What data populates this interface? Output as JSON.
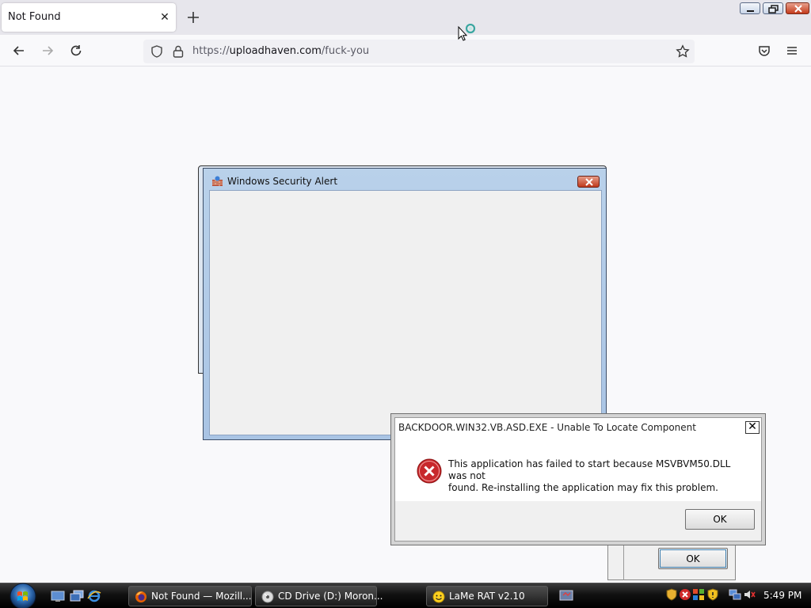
{
  "browser": {
    "tab_title": "Not Found",
    "tab_close_glyph": "✕",
    "url_prefix": "https://",
    "url_host": "uploadhaven.com",
    "url_path": "/fuck-you",
    "icons": {
      "back": "back-arrow-icon",
      "forward": "forward-arrow-icon",
      "reload": "reload-icon",
      "shield": "tracking-shield-icon",
      "lock": "lock-icon",
      "bookmark": "star-icon",
      "pocket": "pocket-icon",
      "menu": "hamburger-menu-icon",
      "new_tab": "plus-icon"
    }
  },
  "security_alert": {
    "title": "Windows Security Alert"
  },
  "error_dialog": {
    "title": "BACKDOOR.WIN32.VB.ASD.EXE - Unable To Locate Component",
    "close_glyph": "✕",
    "message_line1": "This application has failed to start because MSVBVM50.DLL was not",
    "message_line2": "found. Re-installing the application may fix this problem.",
    "ok_label": "OK"
  },
  "background_dialog": {
    "ok_label": "OK"
  },
  "taskbar": {
    "buttons": [
      {
        "label": "Not Found — Mozill...",
        "icon": "firefox-icon"
      },
      {
        "label": "CD Drive (D:) Moron...",
        "icon": "cd-drive-icon"
      },
      {
        "label": "LaMe RAT v2.10",
        "icon": "smiley-icon"
      }
    ],
    "quick_launch": [
      "show-desktop-icon",
      "switch-windows-icon",
      "internet-explorer-icon"
    ],
    "clock": "5:49 PM"
  },
  "colors": {
    "error_red": "#c8282c",
    "taskbar_black": "#111111",
    "titlebar_blue": "#b9d1ea"
  }
}
